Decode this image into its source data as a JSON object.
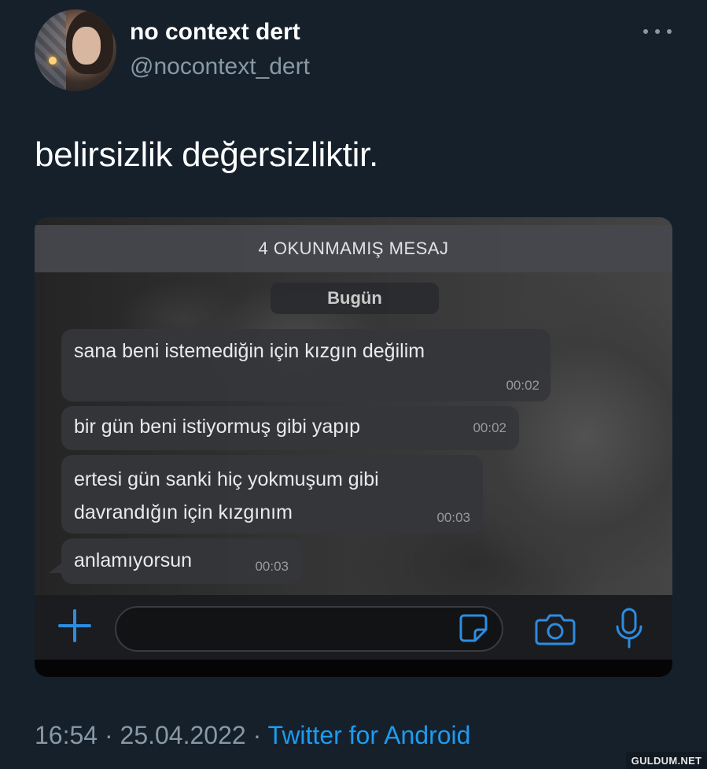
{
  "tweet": {
    "display_name": "no context dert",
    "handle": "@nocontext_dert",
    "text": "belirsizlik değersizliktir.",
    "more_icon": "more-horizontal-icon"
  },
  "screenshot": {
    "unread_banner": "4 OKUNMAMIŞ MESAJ",
    "day_label": "Bugün",
    "messages": [
      {
        "text": "sana beni istemediğin için kızgın değilim",
        "time": "00:02"
      },
      {
        "text": "bir gün beni istiyormuş gibi yapıp",
        "time": "00:02"
      },
      {
        "line1": "ertesi gün sanki hiç yokmuşum gibi",
        "line2": "davrandığın için kızgınım",
        "time": "00:03"
      },
      {
        "text": "anlamıyorsun",
        "time": "00:03"
      }
    ],
    "icons": [
      "plus-icon",
      "sticker-icon",
      "camera-icon",
      "microphone-icon"
    ],
    "accent_color": "#2d8ce0"
  },
  "footer": {
    "time": "16:54",
    "separator": "·",
    "date": "25.04.2022",
    "source": "Twitter for Android"
  },
  "watermark": "GULDUM.NET",
  "colors": {
    "background": "#15202b",
    "secondary_text": "#8899a6",
    "link": "#1d9bf0"
  }
}
